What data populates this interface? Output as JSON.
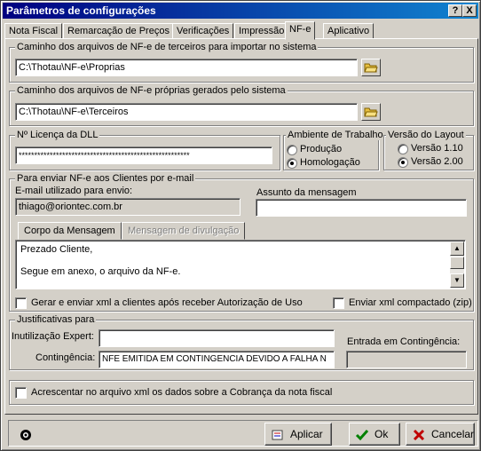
{
  "window": {
    "title": "Parâmetros de configurações",
    "help_label": "?",
    "close_label": "X"
  },
  "tabs": [
    {
      "label": "Nota Fiscal"
    },
    {
      "label": "Remarcação de Preços"
    },
    {
      "label": "Verificações"
    },
    {
      "label": "Impressão"
    },
    {
      "label": "NF-e"
    },
    {
      "label": "Aplicativo"
    }
  ],
  "active_tab": "NF-e",
  "import_path": {
    "legend": "Caminho dos arquivos de NF-e de terceiros para importar no sistema",
    "value": "C:\\Thotau\\NF-e\\Proprias"
  },
  "own_path": {
    "legend": "Caminho dos arquivos de NF-e próprias gerados pelo sistema",
    "value": "C:\\Thotau\\NF-e\\Terceiros"
  },
  "license": {
    "legend": "Nº Licença da DLL",
    "value": "*******************************************************"
  },
  "environment": {
    "legend": "Ambiente de Trabalho",
    "options": [
      "Produção",
      "Homologação"
    ],
    "selected": "Homologação"
  },
  "layout_version": {
    "legend": "Versão do Layout",
    "options": [
      "Versão 1.10",
      "Versão 2.00"
    ],
    "selected": "Versão 2.00"
  },
  "email": {
    "legend": "Para enviar NF-e aos Clientes por e-mail",
    "sender_label": "E-mail utilizado para envio:",
    "sender_value": "thiago@oriontec.com.br",
    "subject_label": "Assunto da mensagem",
    "subject_value": "",
    "subtabs": [
      "Corpo da Mensagem",
      "Mensagem de divulgação"
    ],
    "body_lines": [
      "Prezado Cliente,",
      "Segue em anexo, o arquivo da NF-e."
    ],
    "generate_xml_label": "Gerar e enviar xml a clientes após receber Autorização de Uso",
    "generate_xml_checked": false,
    "compact_label": "Enviar xml compactado (zip)",
    "compact_checked": false
  },
  "justifications": {
    "legend": "Justificativas para",
    "inutilizacao_label": "Inutilização Expert:",
    "inutilizacao_value": "",
    "contingencia_label": "Contingência:",
    "contingencia_value": "NFE EMITIDA EM CONTINGENCIA DEVIDO A FALHA N",
    "entrada_label": "Entrada em Contingência:",
    "entrada_value": ""
  },
  "billing": {
    "label": "Acrescentar no arquivo xml os dados sobre a Cobrança da nota fiscal",
    "checked": false
  },
  "footer": {
    "apply_label": "Aplicar",
    "ok_label": "Ok",
    "cancel_label": "Cancelar"
  },
  "colors": {
    "title_start": "#000080",
    "title_end": "#1084d0",
    "ok_icon": "#008000",
    "cancel_icon": "#c00000",
    "folder_icon": "#e8c040"
  }
}
